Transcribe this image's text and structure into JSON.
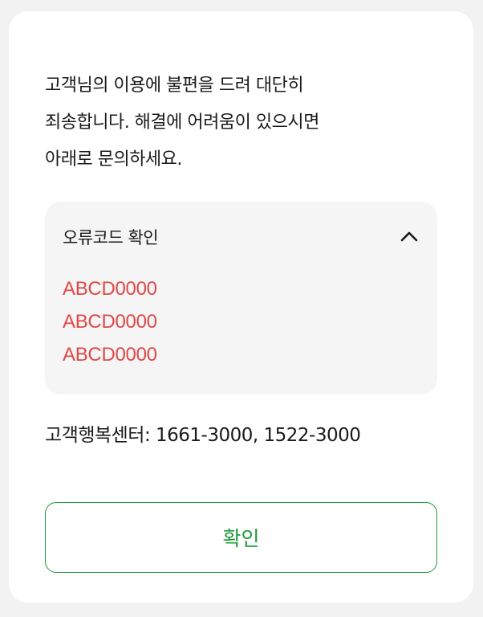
{
  "message": {
    "lines": [
      "고객님의 이용에 불편을 드려 대단히",
      "죄송합니다. 해결에 어려움이 있으시면",
      "아래로 문의하세요."
    ]
  },
  "error_panel": {
    "title": "오류코드 확인",
    "toggle_icon": "chevron-up-icon",
    "codes": [
      "ABCD0000",
      "ABCD0000",
      "ABCD0000"
    ]
  },
  "contact": {
    "text": "고객행복센터: 1661-3000, 1522-3000"
  },
  "confirm_button": {
    "label": "확인"
  },
  "colors": {
    "accent": "#1e9a3c",
    "error": "#e04848",
    "panel_bg": "#f5f5f5"
  }
}
